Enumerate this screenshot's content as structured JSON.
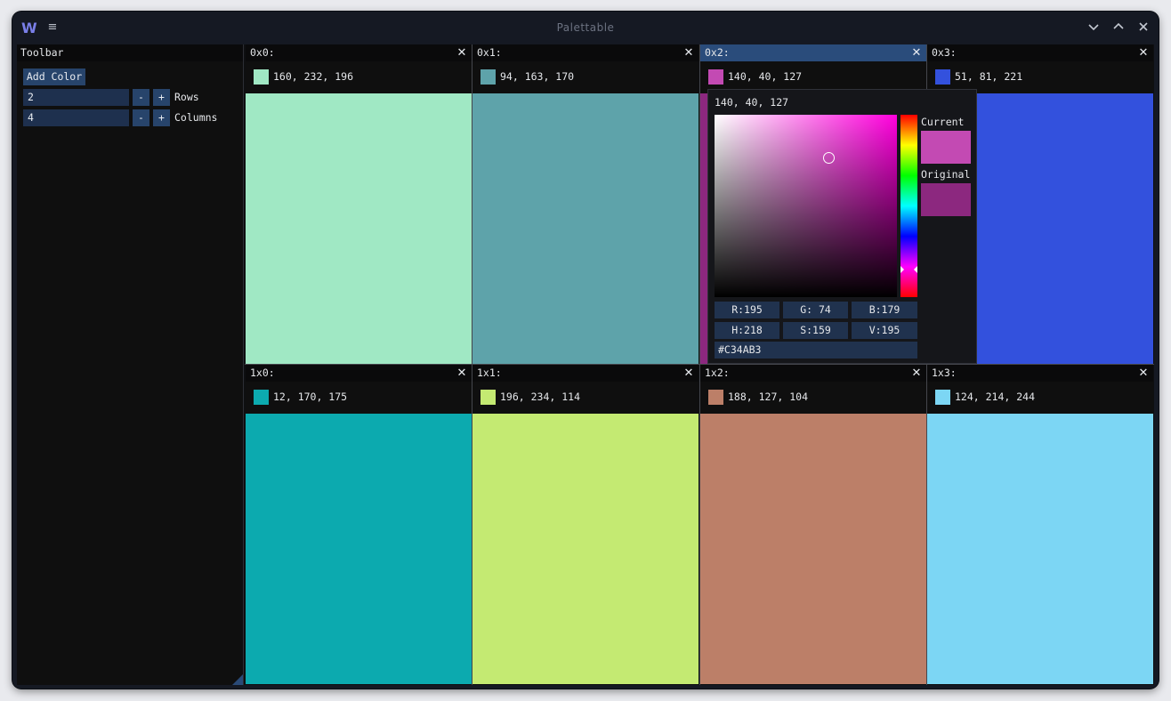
{
  "window": {
    "title": "Palettable",
    "logo": "W"
  },
  "icons": {
    "menu": "hamburger-icon",
    "minimize": "chevron-down-icon",
    "maximize": "chevron-up-icon",
    "close": "close-icon"
  },
  "toolbar": {
    "title": "Toolbar",
    "add_color_label": "Add Color",
    "rows": {
      "value": "2",
      "label": "Rows",
      "minus": "-",
      "plus": "+"
    },
    "columns": {
      "value": "4",
      "label": "Columns",
      "minus": "-",
      "plus": "+"
    }
  },
  "cells": [
    {
      "name": "0x0:",
      "rgb": "160, 232, 196",
      "color": "#a0e8c4"
    },
    {
      "name": "0x1:",
      "rgb": "94, 163, 170",
      "color": "#5ea3aa"
    },
    {
      "name": "0x2:",
      "rgb": "140, 40, 127",
      "color": "#8c287f",
      "swatch": "#c34ab3"
    },
    {
      "name": "0x3:",
      "rgb": "51, 81, 221",
      "color": "#3351dd"
    },
    {
      "name": "1x0:",
      "rgb": "12, 170, 175",
      "color": "#0caaaf"
    },
    {
      "name": "1x1:",
      "rgb": "196, 234, 114",
      "color": "#c4ea72"
    },
    {
      "name": "1x2:",
      "rgb": "188, 127, 104",
      "color": "#bc7f68"
    },
    {
      "name": "1x3:",
      "rgb": "124, 214, 244",
      "color": "#7cd6f4"
    }
  ],
  "close_glyph": "✕",
  "picker": {
    "title": "140, 40, 127",
    "current_label": "Current",
    "original_label": "Original",
    "current_color": "#c34ab3",
    "original_color": "#8c287f",
    "hue_color": "#ff00dd",
    "r": "R:195",
    "g": "G: 74",
    "b": "B:179",
    "h": "H:218",
    "s": "S:159",
    "v": "V:195",
    "hex": "#C34AB3"
  }
}
